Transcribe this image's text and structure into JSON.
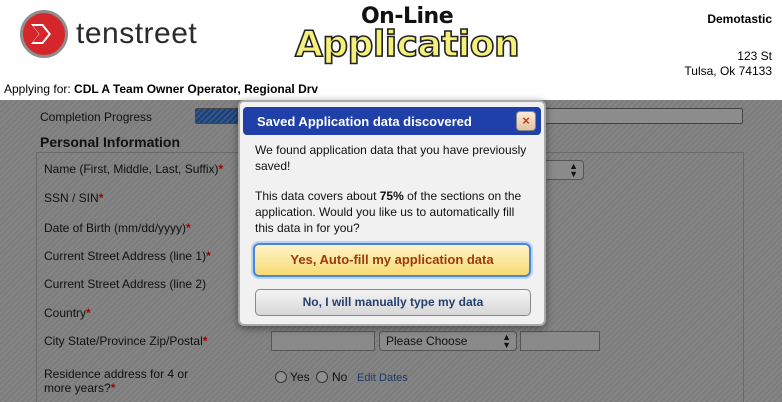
{
  "brand": {
    "name": "tenstreet"
  },
  "title": {
    "line1": "On-Line",
    "line2": "Application"
  },
  "company": {
    "name": "Demotastic",
    "address1": "123 St",
    "address2": "Tulsa, Ok 74133"
  },
  "applying": {
    "label": "Applying for:",
    "position": "CDL A Team Owner Operator, Regional Drv"
  },
  "form": {
    "progress_label": "Completion Progress",
    "progress_fraction": 0.08,
    "section_title": "Personal Information",
    "fields": {
      "name": "Name (First, Middle, Last, Suffix)",
      "ssn": "SSN / SIN",
      "dob": "Date of Birth (mm/dd/yyyy)",
      "street1": "Current Street Address (line 1)",
      "street2": "Current Street Address (line 2)",
      "country": "Country",
      "city": "City State/Province Zip/Postal",
      "residence_l1": "Residence address for 4 or",
      "residence_l2": "more years?"
    },
    "required_mark": "*",
    "state_select": "Please Choose",
    "radio_yes": "Yes",
    "radio_no": "No",
    "edit_dates": "Edit Dates"
  },
  "modal": {
    "title": "Saved Application data discovered",
    "close": "×",
    "para1": "We found application data that you have previously saved!",
    "para2_pre": "This data covers about ",
    "para2_pct": "75%",
    "para2_post": " of the sections on the application. Would you like us to automatically fill this data in for you?",
    "yes_button": "Yes, Auto-fill my application data",
    "no_button": "No, I will manually type my data"
  }
}
